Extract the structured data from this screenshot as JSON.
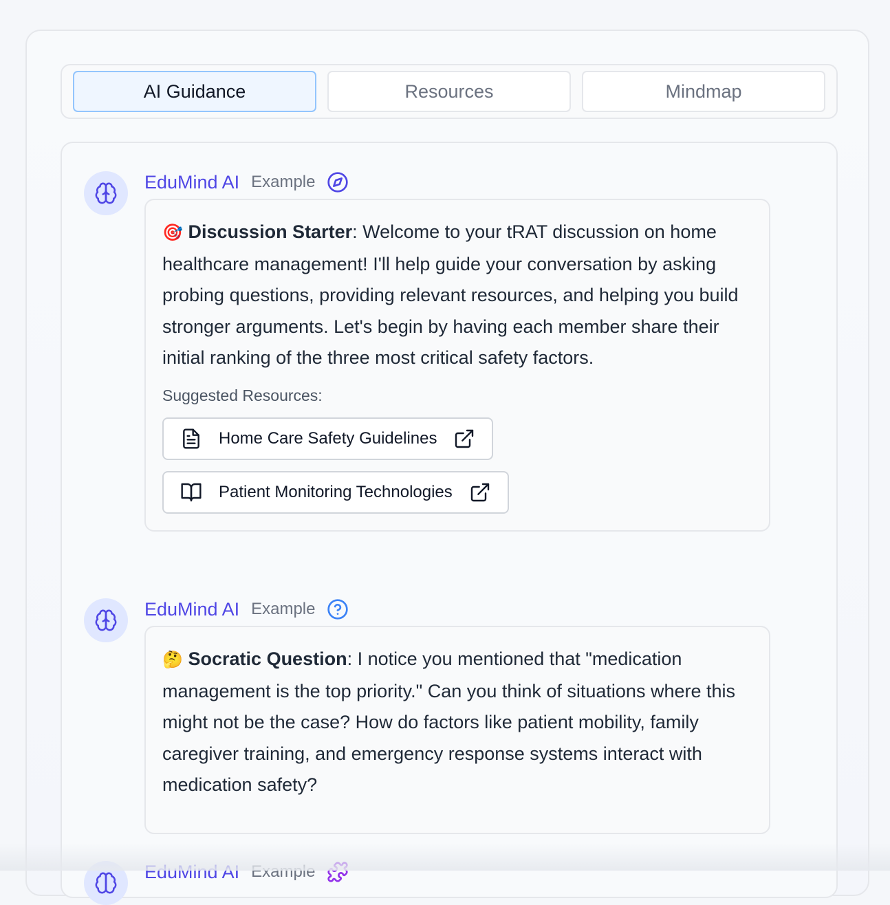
{
  "tabs": [
    {
      "label": "AI Guidance",
      "active": true
    },
    {
      "label": "Resources",
      "active": false
    },
    {
      "label": "Mindmap",
      "active": false
    }
  ],
  "messages": [
    {
      "sender": "EduMind AI",
      "tag": "Example",
      "type_icon": "compass-icon",
      "emoji": "🎯",
      "heading": "Discussion Starter",
      "body": ": Welcome to your tRAT discussion on home healthcare management! I'll help guide your conversation by asking probing questions, providing relevant resources, and helping you build stronger arguments. Let's begin by having each member share their initial ranking of the three most critical safety factors.",
      "resources_title": "Suggested Resources:",
      "resources": [
        {
          "label": "Home Care Safety Guidelines",
          "icon": "document-icon"
        },
        {
          "label": "Patient Monitoring Technologies",
          "icon": "book-icon"
        }
      ]
    },
    {
      "sender": "EduMind AI",
      "tag": "Example",
      "type_icon": "question-circle-icon",
      "emoji": "🤔",
      "heading": "Socratic Question",
      "body": ": I notice you mentioned that \"medication management is the top priority.\" Can you think of situations where this might not be the case? How do factors like patient mobility, family caregiver training, and emergency response systems interact with medication safety?"
    },
    {
      "sender": "EduMind AI",
      "tag": "Example",
      "type_icon": "puzzle-icon"
    }
  ],
  "colors": {
    "accent": "#4f46e5",
    "active_tab_bg": "#eff6ff",
    "active_tab_border": "#93c5fd",
    "avatar_bg": "#e0e7ff",
    "question_icon": "#3b82f6",
    "puzzle_icon": "#9333ea"
  }
}
